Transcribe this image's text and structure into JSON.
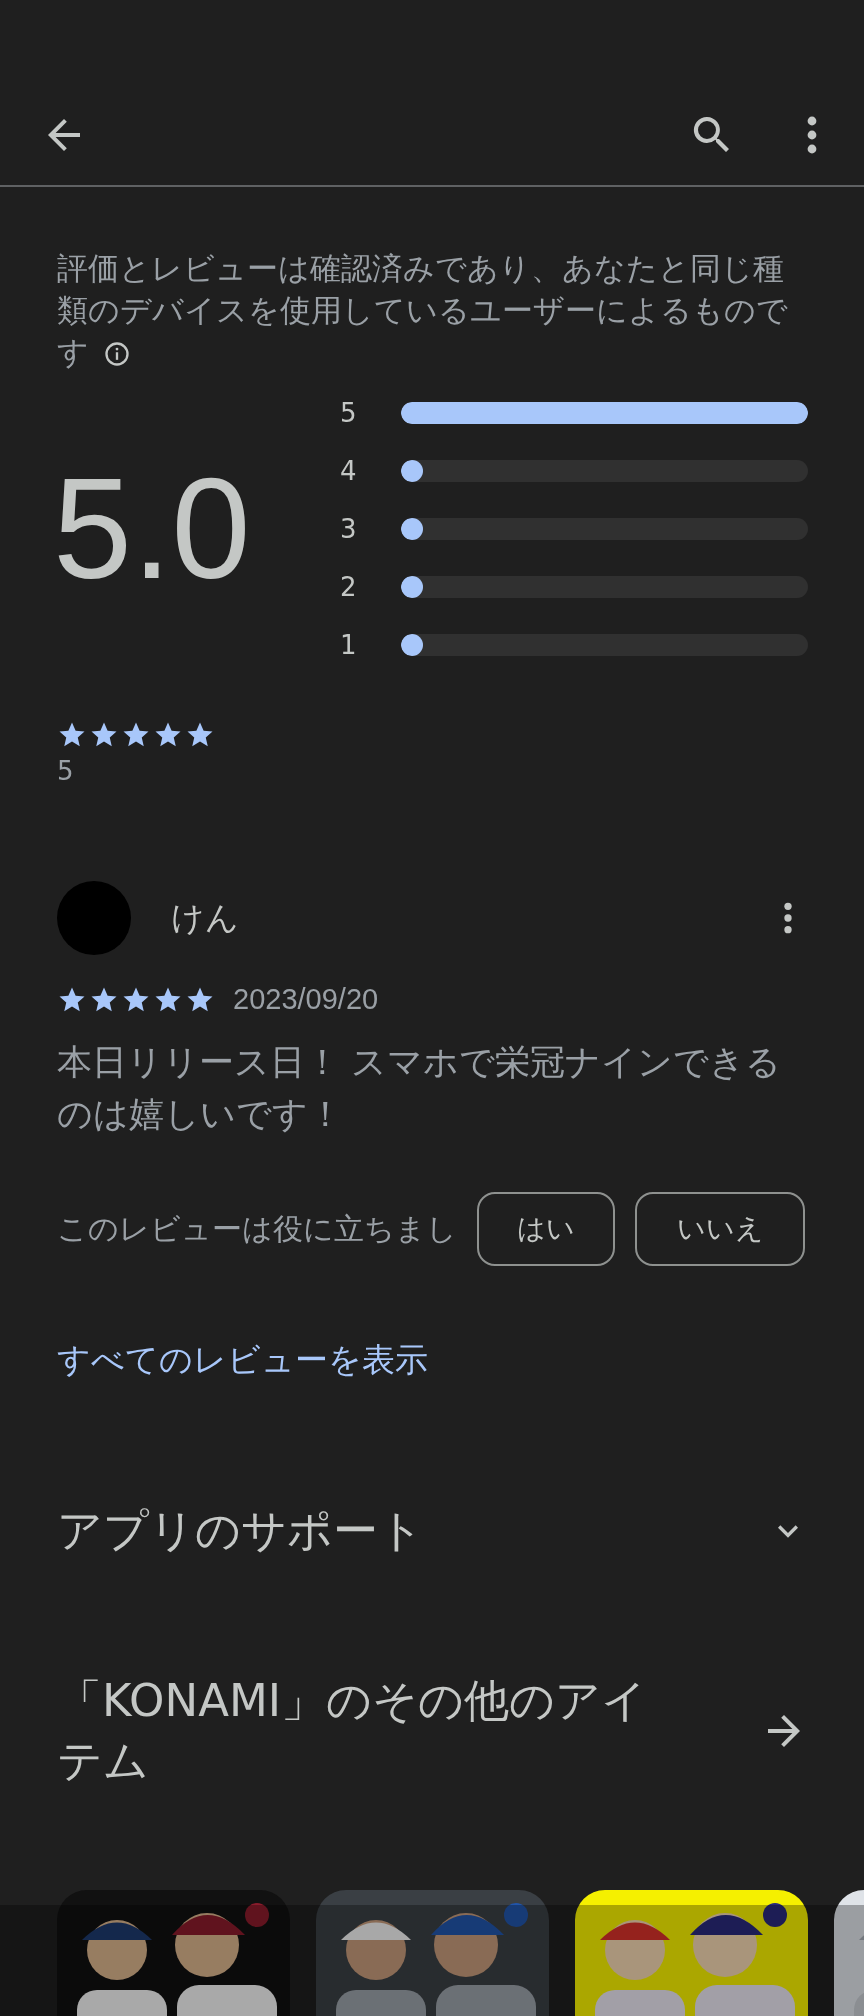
{
  "disclaimer": "評価とレビューは確認済みであり、あなたと同じ種類のデバイスを使用しているユーザーによるものです",
  "rating": {
    "average": "5.0",
    "stars": 5,
    "count": "5",
    "bars": [
      {
        "label": "5",
        "level": 1
      },
      {
        "label": "4",
        "level": 0
      },
      {
        "label": "3",
        "level": 0
      },
      {
        "label": "2",
        "level": 0
      },
      {
        "label": "1",
        "level": 0
      }
    ]
  },
  "review": {
    "name": "けん",
    "stars": 5,
    "date": "2023/09/20",
    "text": "本日リリース日！ スマホで栄冠ナインできるのは嬉しいです！",
    "helpful_prompt": "このレビューは役に立ちまし",
    "buttons": [
      "はい",
      "いいえ"
    ]
  },
  "all_reviews_link": "すべてのレビューを表示",
  "sections": [
    {
      "title": "アプリのサポート",
      "kind": "expand"
    },
    {
      "title": "「KONAMI」のその他のアイテム",
      "kind": "link"
    }
  ]
}
